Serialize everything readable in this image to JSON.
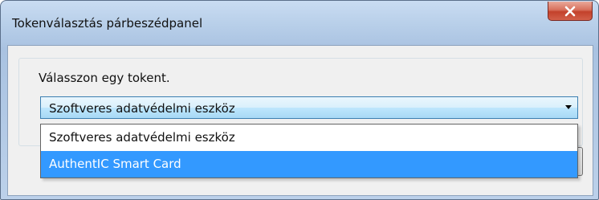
{
  "window": {
    "title": "Tokenválasztás párbeszédpanel",
    "close_icon": "close-icon"
  },
  "dialog": {
    "prompt": "Válasszon egy tokent.",
    "token_select": {
      "selected_value": "Szoftveres adatvédelmi eszköz",
      "options": [
        {
          "label": "Szoftveres adatvédelmi eszköz",
          "highlighted": false
        },
        {
          "label": "AuthentIC Smart Card",
          "highlighted": true
        }
      ]
    }
  },
  "colors": {
    "highlight": "#3399ff",
    "close_button": "#c3412b"
  }
}
